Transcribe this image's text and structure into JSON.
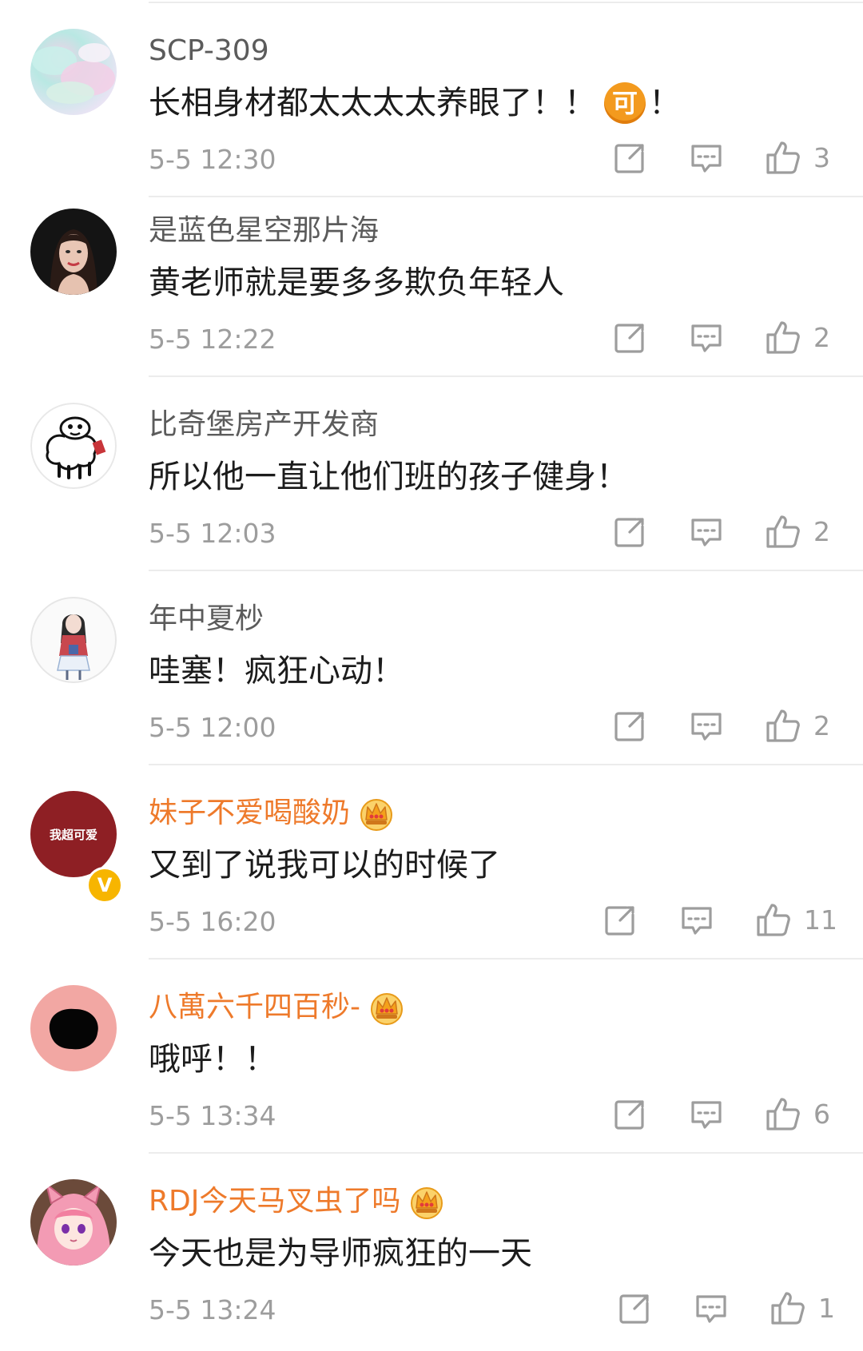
{
  "comments": [
    {
      "username": "SCP-309",
      "vip": false,
      "content": "长相身材都太太太太养眼了！！",
      "emoji": "可",
      "content_tail": "！",
      "time": "5-5 12:30",
      "likes": "3",
      "avatar": "pastel-cloud-avatar"
    },
    {
      "username": "是蓝色星空那片海",
      "vip": false,
      "content": "黄老师就是要多多欺负年轻人",
      "time": "5-5 12:22",
      "likes": "2",
      "avatar": "woman-portrait-avatar"
    },
    {
      "username": "比奇堡房产开发商",
      "vip": false,
      "content": "所以他一直让他们班的孩子健身！",
      "time": "5-5 12:03",
      "likes": "2",
      "avatar": "sheep-drawing-avatar"
    },
    {
      "username": "年中夏杪",
      "vip": false,
      "content": "哇塞！疯狂心动！",
      "time": "5-5 12:00",
      "likes": "2",
      "avatar": "girl-illustration-avatar"
    },
    {
      "username": "妹子不爱喝酸奶",
      "vip": true,
      "verified": true,
      "avatar_text": "我超可爱",
      "content": "又到了说我可以的时候了",
      "time": "5-5 16:20",
      "likes": "11",
      "avatar": "red-text-avatar"
    },
    {
      "username": "八萬六千四百秒-",
      "vip": true,
      "content": "哦呼！！",
      "time": "5-5 13:34",
      "likes": "6",
      "avatar": "pink-black-blob-avatar"
    },
    {
      "username": "RDJ今天马叉虫了吗",
      "vip": true,
      "content": "今天也是为导师疯狂的一天",
      "time": "5-5 13:24",
      "likes": "1",
      "avatar": "anime-fox-girl-avatar"
    }
  ],
  "icons": {
    "share": "share-icon",
    "reply": "comment-icon",
    "like": "thumbs-up-icon",
    "vip": "crown-badge-icon",
    "verified": "verified-v-icon"
  },
  "colors": {
    "vip_name": "#ee7a2b",
    "normal_name": "#5b5b5b",
    "content": "#1c1c1c",
    "meta": "#9d9d9d",
    "verified_badge": "#f7b500"
  }
}
